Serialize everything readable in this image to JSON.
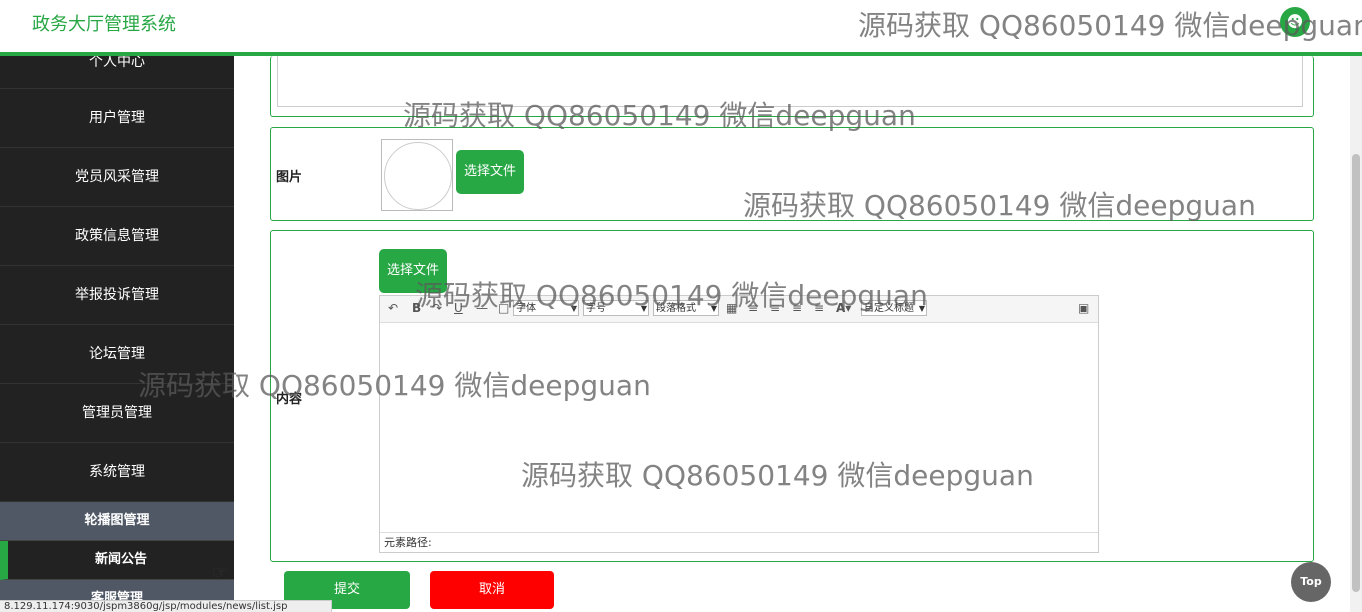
{
  "header": {
    "title": "政务大厅管理系统",
    "avatar_icon": "user-icon"
  },
  "sidebar": {
    "items": [
      {
        "label": "个人中心"
      },
      {
        "label": "用户管理"
      },
      {
        "label": "党员风采管理"
      },
      {
        "label": "政策信息管理"
      },
      {
        "label": "举报投诉管理"
      },
      {
        "label": "论坛管理"
      },
      {
        "label": "管理员管理"
      },
      {
        "label": "系统管理"
      }
    ],
    "submenu": [
      {
        "label": "轮播图管理"
      },
      {
        "label": "新闻公告",
        "active": true
      },
      {
        "label": "客服管理"
      }
    ]
  },
  "form": {
    "image_label": "图片",
    "image_choose_button": "选择文件",
    "content_label": "内容",
    "content_choose_button": "选择文件",
    "editor": {
      "toolbar": {
        "font": "字体",
        "font_size": "字号",
        "paragraph": "段落格式",
        "custom_title": "自定义标题"
      },
      "status_label": "元素路径:"
    },
    "submit_button": "提交",
    "cancel_button": "取消"
  },
  "top_button": "Top",
  "status_url": "8.129.11.174:9030/jspm3860g/jsp/modules/news/list.jsp",
  "watermark": "源码获取 QQ86050149 微信deepguan",
  "colors": {
    "accent": "#28a745",
    "danger": "#ff0000",
    "sidebar": "#222222"
  }
}
